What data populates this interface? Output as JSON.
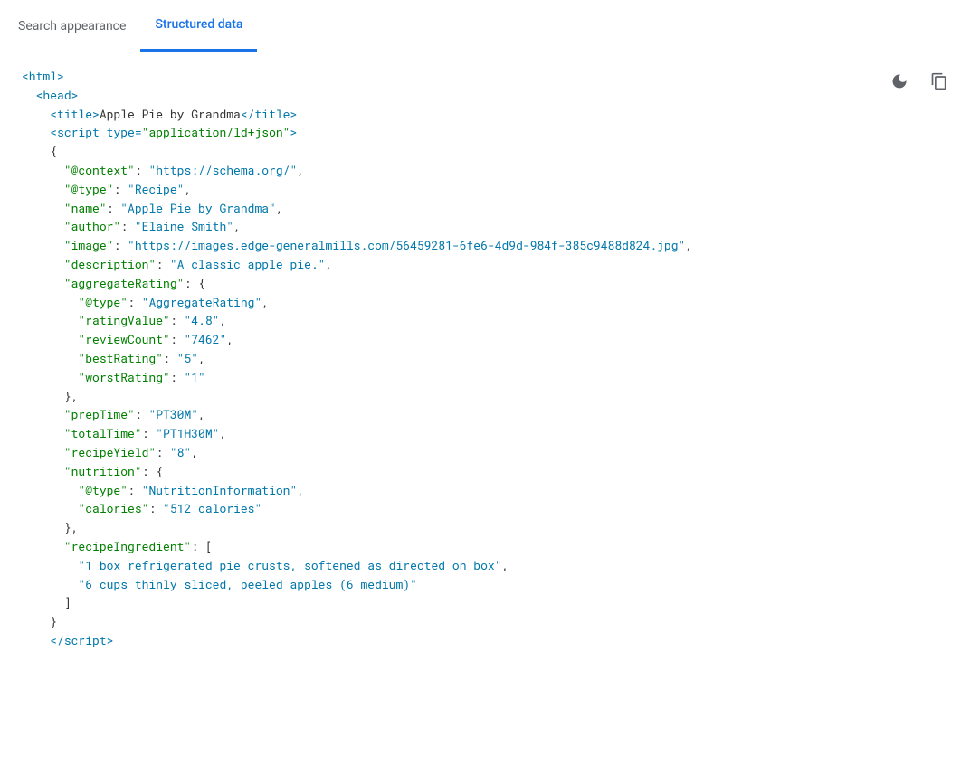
{
  "header": {
    "nav_items": [
      {
        "label": "Search appearance",
        "active": false
      },
      {
        "label": "Structured data",
        "active": true
      }
    ]
  },
  "toolbar": {
    "theme_btn_title": "Toggle theme",
    "copy_btn_title": "Copy code"
  },
  "code": {
    "lines": [
      {
        "id": 1,
        "html": "<span class='html-tag'>&lt;html&gt;</span>"
      },
      {
        "id": 2,
        "html": "  <span class='html-tag'>&lt;head&gt;</span>"
      },
      {
        "id": 3,
        "html": "    <span class='html-tag'>&lt;title&gt;</span><span class='json-punc'>Apple Pie by Grandma</span><span class='html-tag'>&lt;/title&gt;</span>"
      },
      {
        "id": 4,
        "html": "    <span class='html-tag'>&lt;script</span> <span class='c-attr'>type=</span><span class='c-string-attr'>\"application/ld+json\"</span><span class='html-tag'>&gt;</span>"
      },
      {
        "id": 5,
        "html": "    <span class='json-punc'>{</span>"
      },
      {
        "id": 6,
        "html": "      <span class='json-key'>\"@context\"</span><span class='json-punc'>: </span><span class='json-val'>\"https://schema.org/\"</span><span class='json-punc'>,</span>"
      },
      {
        "id": 7,
        "html": "      <span class='json-key'>\"@type\"</span><span class='json-punc'>: </span><span class='json-val'>\"Recipe\"</span><span class='json-punc'>,</span>"
      },
      {
        "id": 8,
        "html": "      <span class='json-key'>\"name\"</span><span class='json-punc'>: </span><span class='json-val'>\"Apple Pie by Grandma\"</span><span class='json-punc'>,</span>"
      },
      {
        "id": 9,
        "html": "      <span class='json-key'>\"author\"</span><span class='json-punc'>: </span><span class='json-val'>\"Elaine Smith\"</span><span class='json-punc'>,</span>"
      },
      {
        "id": 10,
        "html": "      <span class='json-key'>\"image\"</span><span class='json-punc'>: </span><span class='json-val'>\"https://images.edge-generalmills.com/56459281-6fe6-4d9d-984f-385c9488d824.jpg\"</span><span class='json-punc'>,</span>"
      },
      {
        "id": 11,
        "html": "      <span class='json-key'>\"description\"</span><span class='json-punc'>: </span><span class='json-val'>\"A classic apple pie.\"</span><span class='json-punc'>,</span>"
      },
      {
        "id": 12,
        "html": "      <span class='json-key'>\"aggregateRating\"</span><span class='json-punc'>: {</span>"
      },
      {
        "id": 13,
        "html": "        <span class='json-key'>\"@type\"</span><span class='json-punc'>: </span><span class='json-val'>\"AggregateRating\"</span><span class='json-punc'>,</span>"
      },
      {
        "id": 14,
        "html": "        <span class='json-key'>\"ratingValue\"</span><span class='json-punc'>: </span><span class='json-val'>\"4.8\"</span><span class='json-punc'>,</span>"
      },
      {
        "id": 15,
        "html": "        <span class='json-key'>\"reviewCount\"</span><span class='json-punc'>: </span><span class='json-val'>\"7462\"</span><span class='json-punc'>,</span>"
      },
      {
        "id": 16,
        "html": "        <span class='json-key'>\"bestRating\"</span><span class='json-punc'>: </span><span class='json-val'>\"5\"</span><span class='json-punc'>,</span>"
      },
      {
        "id": 17,
        "html": "        <span class='json-key'>\"worstRating\"</span><span class='json-punc'>: </span><span class='json-val'>\"1\"</span>"
      },
      {
        "id": 18,
        "html": "      <span class='json-punc'>},</span>"
      },
      {
        "id": 19,
        "html": "      <span class='json-key'>\"prepTime\"</span><span class='json-punc'>: </span><span class='json-val'>\"PT30M\"</span><span class='json-punc'>,</span>"
      },
      {
        "id": 20,
        "html": "      <span class='json-key'>\"totalTime\"</span><span class='json-punc'>: </span><span class='json-val'>\"PT1H30M\"</span><span class='json-punc'>,</span>"
      },
      {
        "id": 21,
        "html": "      <span class='json-key'>\"recipeYield\"</span><span class='json-punc'>: </span><span class='json-val'>\"8\"</span><span class='json-punc'>,</span>"
      },
      {
        "id": 22,
        "html": "      <span class='json-key'>\"nutrition\"</span><span class='json-punc'>: {</span>"
      },
      {
        "id": 23,
        "html": "        <span class='json-key'>\"@type\"</span><span class='json-punc'>: </span><span class='json-val'>\"NutritionInformation\"</span><span class='json-punc'>,</span>"
      },
      {
        "id": 24,
        "html": "        <span class='json-key'>\"calories\"</span><span class='json-punc'>: </span><span class='json-val'>\"512 calories\"</span>"
      },
      {
        "id": 25,
        "html": "      <span class='json-punc'>},</span>"
      },
      {
        "id": 26,
        "html": "      <span class='json-key'>\"recipeIngredient\"</span><span class='json-punc'>: [</span>"
      },
      {
        "id": 27,
        "html": "        <span class='json-val'>\"1 box refrigerated pie crusts, softened as directed on box\"</span><span class='json-punc'>,</span>"
      },
      {
        "id": 28,
        "html": "        <span class='json-val'>\"6 cups thinly sliced, peeled apples (6 medium)\"</span>"
      },
      {
        "id": 29,
        "html": "      <span class='json-punc'>]</span>"
      },
      {
        "id": 30,
        "html": "    <span class='json-punc'>}</span>"
      },
      {
        "id": 31,
        "html": "    <span class='html-tag'>&lt;/script&gt;</span>"
      }
    ]
  }
}
